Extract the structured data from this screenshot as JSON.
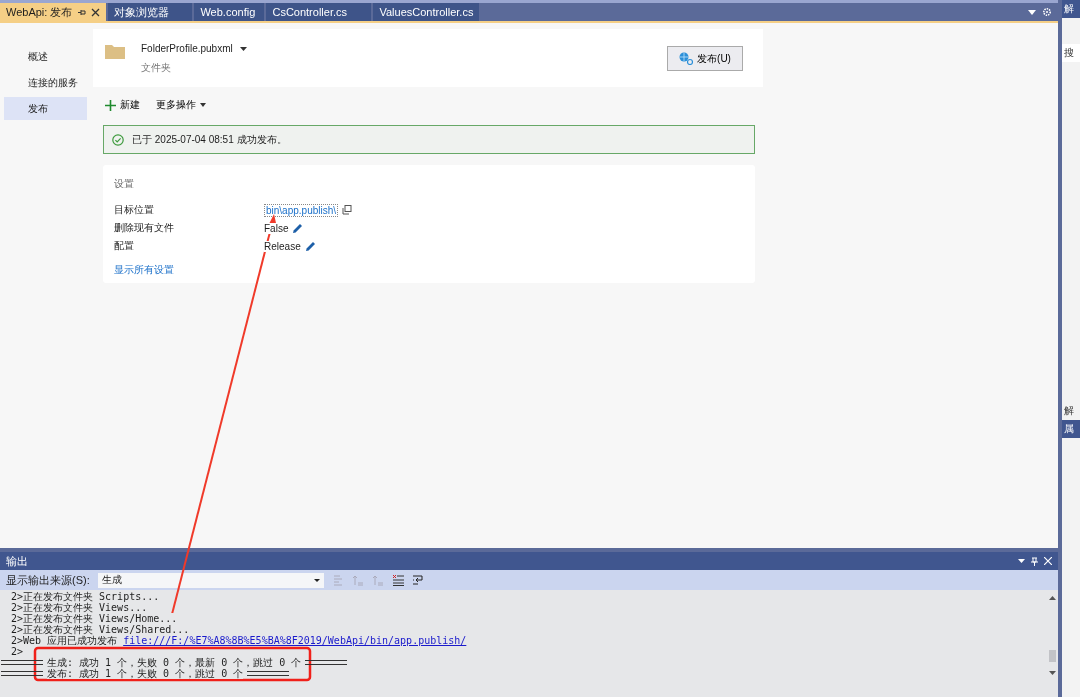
{
  "tabs": [
    {
      "label": "WebApi: 发布",
      "selected": true
    },
    {
      "label": "对象浏览器",
      "selected": false
    },
    {
      "label": "Web.config",
      "selected": false
    },
    {
      "label": "CsController.cs",
      "selected": false
    },
    {
      "label": "ValuesController.cs",
      "selected": false
    }
  ],
  "nav": [
    {
      "label": "概述",
      "selected": false
    },
    {
      "label": "连接的服务",
      "selected": false
    },
    {
      "label": "发布",
      "selected": true
    }
  ],
  "profile": {
    "name": "FolderProfile.pubxml",
    "type": "文件夹",
    "publish_button": "发布(U)"
  },
  "actions": {
    "new": "新建",
    "more": "更多操作"
  },
  "banner": "已于 2025-07-04 08:51 成功发布。",
  "settings": {
    "title": "设置",
    "rows": [
      {
        "label": "目标位置",
        "value": "bin\\app.publish\\",
        "kind": "link"
      },
      {
        "label": "删除现有文件",
        "value": "False",
        "kind": "edit"
      },
      {
        "label": "配置",
        "value": "Release",
        "kind": "edit"
      }
    ],
    "show_all": "显示所有设置"
  },
  "output": {
    "title": "输出",
    "source_label": "显示输出来源(S):",
    "source": "生成",
    "lines": [
      {
        "kind": "plain",
        "text": "2>正在发布文件夹 Scripts..."
      },
      {
        "kind": "plain",
        "text": "2>正在发布文件夹 Views..."
      },
      {
        "kind": "plain",
        "text": "2>正在发布文件夹 Views/Home..."
      },
      {
        "kind": "plain",
        "text": "2>正在发布文件夹 Views/Shared..."
      },
      {
        "kind": "link",
        "text": "2>Web 应用已成功发布 ",
        "link": "file:///F:/%E7%A8%8B%E5%BA%8F2019/WebApi/bin/app.publish/"
      },
      {
        "kind": "plain",
        "text": "2>"
      },
      {
        "kind": "summary",
        "text": "生成: 成功 1 个，失败 0 个，最新 0 个，跳过 0 个"
      },
      {
        "kind": "summary",
        "text": "发布: 成功 1 个，失败 0 个，跳过 0 个"
      }
    ]
  },
  "side_panel": [
    "解",
    "搜",
    "解",
    "属"
  ]
}
